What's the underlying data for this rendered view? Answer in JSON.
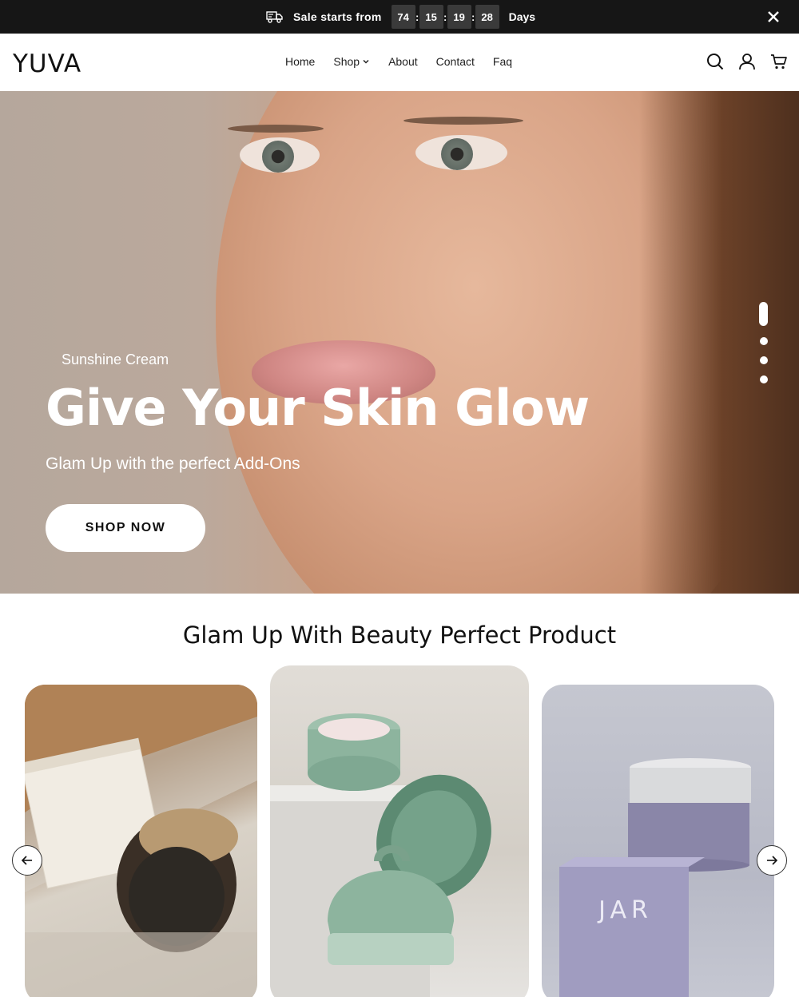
{
  "announcement": {
    "sale_text": "Sale starts from",
    "countdown": [
      "74",
      "15",
      "19",
      "28"
    ],
    "separator": ":",
    "unit": "Days"
  },
  "header": {
    "logo": "YUVA",
    "nav": [
      "Home",
      "Shop",
      "About",
      "Contact",
      "Faq"
    ]
  },
  "hero": {
    "subtitle": "Sunshine Cream",
    "title": "Give Your Skin Glow",
    "description": "Glam Up with the perfect Add-Ons",
    "button": "SHOP NOW",
    "slides_count": 4,
    "active_slide": 1
  },
  "products_section": {
    "title": "Glam Up With Beauty Perfect Product",
    "card3_box_text": "JAR"
  },
  "colors": {
    "topbar_bg": "#161616",
    "countdown_box": "#3a3a3a",
    "text_dark": "#111111",
    "white": "#ffffff"
  },
  "icons": [
    "truck-icon",
    "close-icon",
    "chevron-down-icon",
    "search-icon",
    "user-icon",
    "cart-icon",
    "arrow-left-icon",
    "arrow-right-icon"
  ]
}
